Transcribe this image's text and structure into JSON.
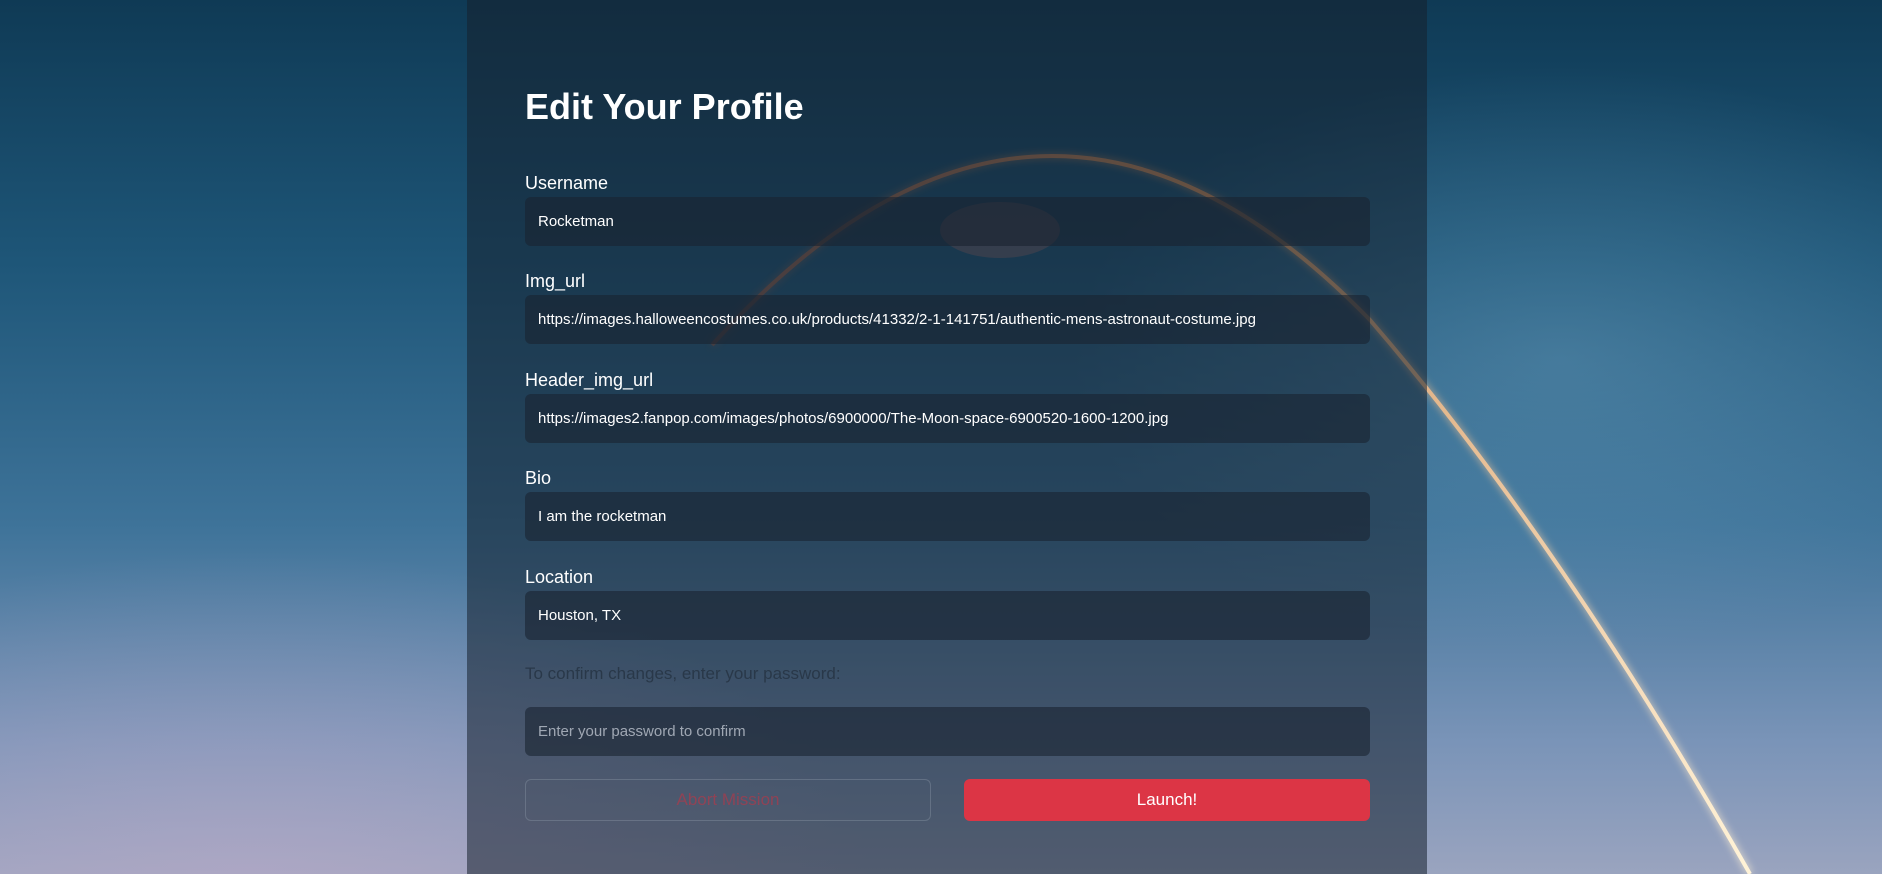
{
  "form": {
    "title": "Edit Your Profile",
    "fields": [
      {
        "label": "Username",
        "value": "Rocketman"
      },
      {
        "label": "Img_url",
        "value": "https://images.halloweencostumes.co.uk/products/41332/2-1-141751/authentic-mens-astronaut-costume.jpg"
      },
      {
        "label": "Header_img_url",
        "value": "https://images2.fanpop.com/images/photos/6900000/The-Moon-space-6900520-1600-1200.jpg"
      },
      {
        "label": "Bio",
        "value": "I am the rocketman"
      },
      {
        "label": "Location",
        "value": "Houston, TX"
      }
    ],
    "confirm_text": "To confirm changes, enter your password:",
    "password_placeholder": "Enter your password to confirm",
    "abort_label": "Abort Mission",
    "launch_label": "Launch!"
  },
  "colors": {
    "launch_button": "#dc3545",
    "abort_text": "#c83241"
  }
}
